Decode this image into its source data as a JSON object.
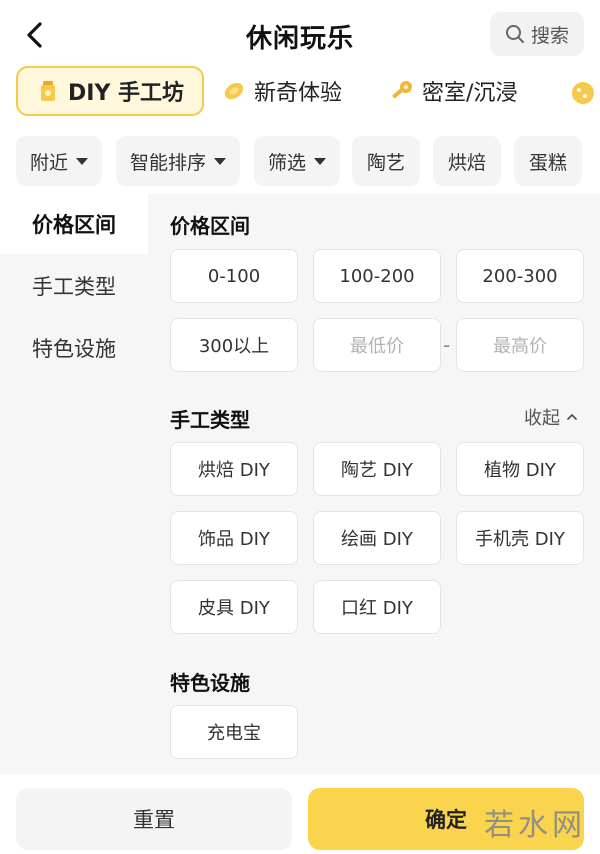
{
  "header": {
    "title": "休闲玩乐",
    "search_label": "搜索"
  },
  "category_tabs": [
    {
      "label": "DIY 手工坊",
      "icon": "jar-icon"
    },
    {
      "label": "新奇体验",
      "icon": "lemon-icon"
    },
    {
      "label": "密室/沉浸",
      "icon": "key-icon"
    }
  ],
  "filters": [
    {
      "label": "附近",
      "has_caret": true
    },
    {
      "label": "智能排序",
      "has_caret": true
    },
    {
      "label": "筛选",
      "has_caret": true
    },
    {
      "label": "陶艺",
      "has_caret": false
    },
    {
      "label": "烘焙",
      "has_caret": false
    },
    {
      "label": "蛋糕",
      "has_caret": false
    }
  ],
  "sidebar": {
    "items": [
      "价格区间",
      "手工类型",
      "特色设施"
    ]
  },
  "price": {
    "title": "价格区间",
    "options": [
      "0-100",
      "100-200",
      "200-300",
      "300以上"
    ],
    "min_placeholder": "最低价",
    "max_placeholder": "最高价",
    "separator": "-"
  },
  "craft": {
    "title": "手工类型",
    "collapse_label": "收起",
    "options": [
      "烘焙 DIY",
      "陶艺 DIY",
      "植物 DIY",
      "饰品 DIY",
      "绘画 DIY",
      "手机壳 DIY",
      "皮具 DIY",
      "口红 DIY"
    ]
  },
  "facility": {
    "title": "特色设施",
    "options": [
      "充电宝"
    ]
  },
  "footer": {
    "reset_label": "重置",
    "confirm_label": "确定",
    "watermark": "若水网"
  },
  "colors": {
    "accent": "#f9d44c",
    "tab_border": "#f6c94a",
    "tab_bg": "#fff8dc"
  }
}
